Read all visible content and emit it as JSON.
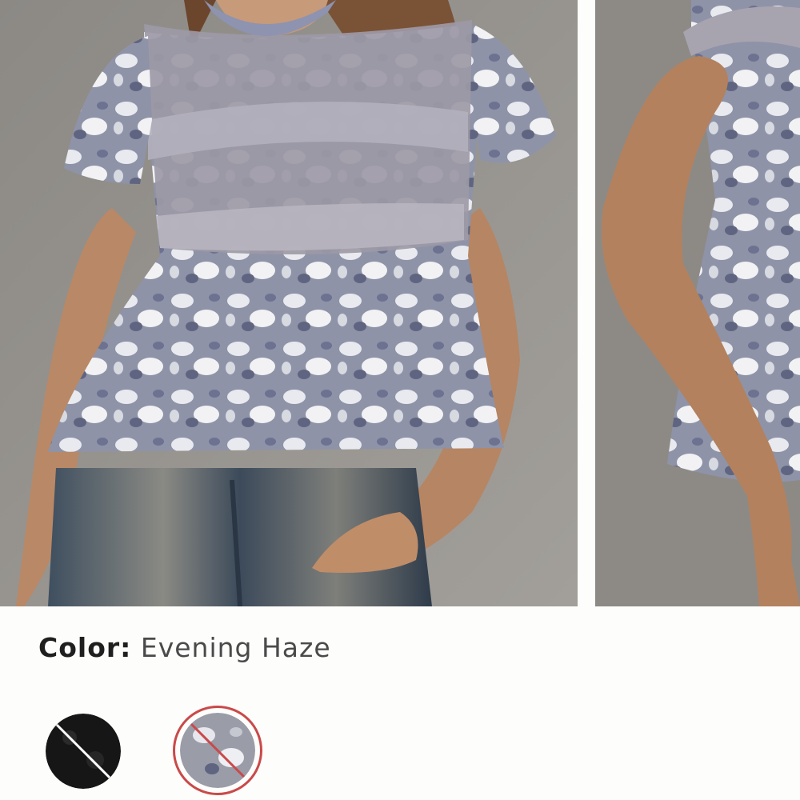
{
  "product": {
    "images": [
      {
        "alt": "product-image-front"
      },
      {
        "alt": "product-image-side"
      }
    ]
  },
  "color_selector": {
    "label": "Color:",
    "selected_value": "Evening Haze",
    "swatches": [
      {
        "name": "Black",
        "color": "#151515",
        "available": false,
        "selected": false
      },
      {
        "name": "Evening Haze",
        "color": "#9a9ca8",
        "available": false,
        "selected": true
      }
    ]
  },
  "colors": {
    "background": "#fdfdfb",
    "photo_backdrop": "#8e8b87",
    "selected_ring": "#c94a4a"
  }
}
